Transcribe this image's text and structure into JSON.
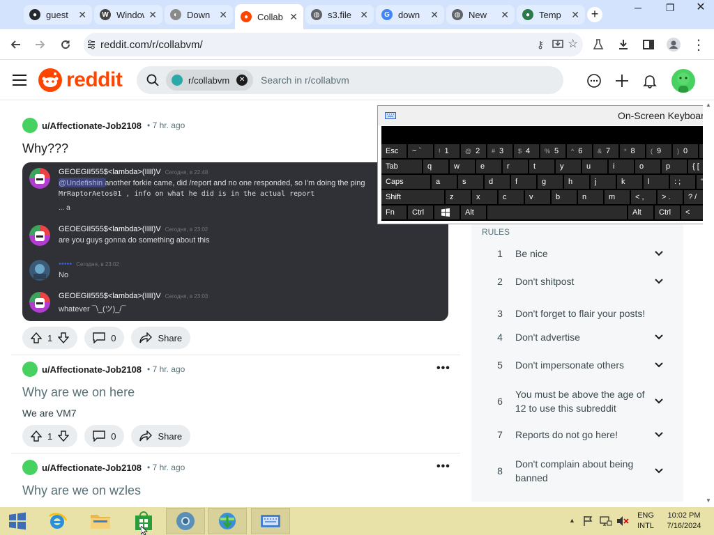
{
  "browser": {
    "tabs": [
      {
        "title": "guest",
        "favicon": "github-icon",
        "active": false
      },
      {
        "title": "Windows",
        "favicon": "wikipedia-icon",
        "active": false
      },
      {
        "title": "Down",
        "favicon": "download-site-icon",
        "active": false
      },
      {
        "title": "Collab",
        "favicon": "reddit-icon",
        "active": true
      },
      {
        "title": "s3.file",
        "favicon": "globe-icon",
        "active": false
      },
      {
        "title": "down",
        "favicon": "google-icon",
        "active": false
      },
      {
        "title": "New",
        "favicon": "globe-icon",
        "active": false
      },
      {
        "title": "Temp",
        "favicon": "temp-site-icon",
        "active": false
      }
    ],
    "new_tab": "+",
    "url": "reddit.com/r/collabvm/"
  },
  "reddit": {
    "logo_text": "reddit",
    "search_chip": "r/collabvm",
    "search_placeholder": "Search in r/collabvm"
  },
  "posts": [
    {
      "author": "u/Affectionate-Job2108",
      "time": "• 7 hr. ago",
      "title": "Why???",
      "votes": "1",
      "comments": "0",
      "share": "Share",
      "image": {
        "messages": [
          {
            "name": "GEOEGII555$<lambda>(IIII)V",
            "time": "Сегодня, в 22:48",
            "lines": [
              "@Undefishin another forkie came, did /report and no one responded, so I'm doing the ping",
              "MrRaptorAetos01 , info on what he did is in the actual report",
              "... a"
            ]
          },
          {
            "name": "GEOEGII555$<lambda>(IIII)V",
            "time": "Сегодня, в 23:02",
            "lines": [
              "are you guys gonna do something about this"
            ]
          },
          {
            "name": "•••••",
            "time": "Сегодня, в 23:02",
            "lines": [
              "No"
            ]
          },
          {
            "name": "GEOEGII555$<lambda>(IIII)V",
            "time": "Сегодня, в 23:03",
            "lines": [
              "whatever ¯\\_(ツ)_/¯"
            ]
          }
        ]
      }
    },
    {
      "author": "u/Affectionate-Job2108",
      "time": "• 7 hr. ago",
      "title": "Why are we on here",
      "body": "We are VM7",
      "votes": "1",
      "comments": "0",
      "share": "Share"
    },
    {
      "author": "u/Affectionate-Job2108",
      "time": "• 7 hr. ago",
      "title": "Why are we on wzles"
    }
  ],
  "sidebar": {
    "rules_heading": "RULES",
    "rules": [
      {
        "num": "1",
        "text": "Be nice",
        "expandable": true
      },
      {
        "num": "2",
        "text": "Don't shitpost",
        "expandable": true
      },
      {
        "num": "3",
        "text": "Don't forget to flair your posts!",
        "expandable": false
      },
      {
        "num": "4",
        "text": "Don't advertise",
        "expandable": true
      },
      {
        "num": "5",
        "text": "Don't impersonate others",
        "expandable": true
      },
      {
        "num": "6",
        "text": "You must be above the age of 12 to use this subreddit",
        "expandable": true
      },
      {
        "num": "7",
        "text": "Reports do not go here!",
        "expandable": true
      },
      {
        "num": "8",
        "text": "Don't complain about being banned",
        "expandable": true
      }
    ]
  },
  "osk": {
    "title": "On-Screen Keyboard",
    "rows": [
      [
        {
          "k": "Esc"
        },
        {
          "k": "~ `"
        },
        {
          "k": "1",
          "s": "!"
        },
        {
          "k": "2",
          "s": "@"
        },
        {
          "k": "3",
          "s": "#"
        },
        {
          "k": "4",
          "s": "$"
        },
        {
          "k": "5",
          "s": "%"
        },
        {
          "k": "6",
          "s": "^"
        },
        {
          "k": "7",
          "s": "&"
        },
        {
          "k": "8",
          "s": "*"
        },
        {
          "k": "9",
          "s": "("
        },
        {
          "k": "0",
          "s": ")"
        },
        {
          "k": "_ -"
        }
      ],
      [
        {
          "k": "Tab"
        },
        {
          "k": "q"
        },
        {
          "k": "w"
        },
        {
          "k": "e"
        },
        {
          "k": "r"
        },
        {
          "k": "t"
        },
        {
          "k": "y"
        },
        {
          "k": "u"
        },
        {
          "k": "i"
        },
        {
          "k": "o"
        },
        {
          "k": "p"
        },
        {
          "k": "{ ["
        }
      ],
      [
        {
          "k": "Caps"
        },
        {
          "k": "a"
        },
        {
          "k": "s"
        },
        {
          "k": "d"
        },
        {
          "k": "f"
        },
        {
          "k": "g"
        },
        {
          "k": "h"
        },
        {
          "k": "j"
        },
        {
          "k": "k"
        },
        {
          "k": "l"
        },
        {
          "k": ": ;"
        },
        {
          "k": "\" '"
        }
      ],
      [
        {
          "k": "Shift"
        },
        {
          "k": "z"
        },
        {
          "k": "x"
        },
        {
          "k": "c"
        },
        {
          "k": "v"
        },
        {
          "k": "b"
        },
        {
          "k": "n"
        },
        {
          "k": "m"
        },
        {
          "k": "< ,"
        },
        {
          "k": "> ."
        },
        {
          "k": "? /"
        }
      ],
      [
        {
          "k": "Fn"
        },
        {
          "k": "Ctrl"
        },
        {
          "k": "win"
        },
        {
          "k": "Alt"
        },
        {
          "k": ""
        },
        {
          "k": "Alt"
        },
        {
          "k": "Ctrl"
        },
        {
          "k": "<"
        }
      ]
    ]
  },
  "taskbar": {
    "lang": "ENG",
    "lang_sub": "INTL",
    "time": "10:02 PM",
    "date": "7/16/2024"
  },
  "colors": {
    "reddit_orange": "#ff4500",
    "taskbar": "#e8e2a8",
    "chrome_tabstrip": "#d3e3fd"
  }
}
